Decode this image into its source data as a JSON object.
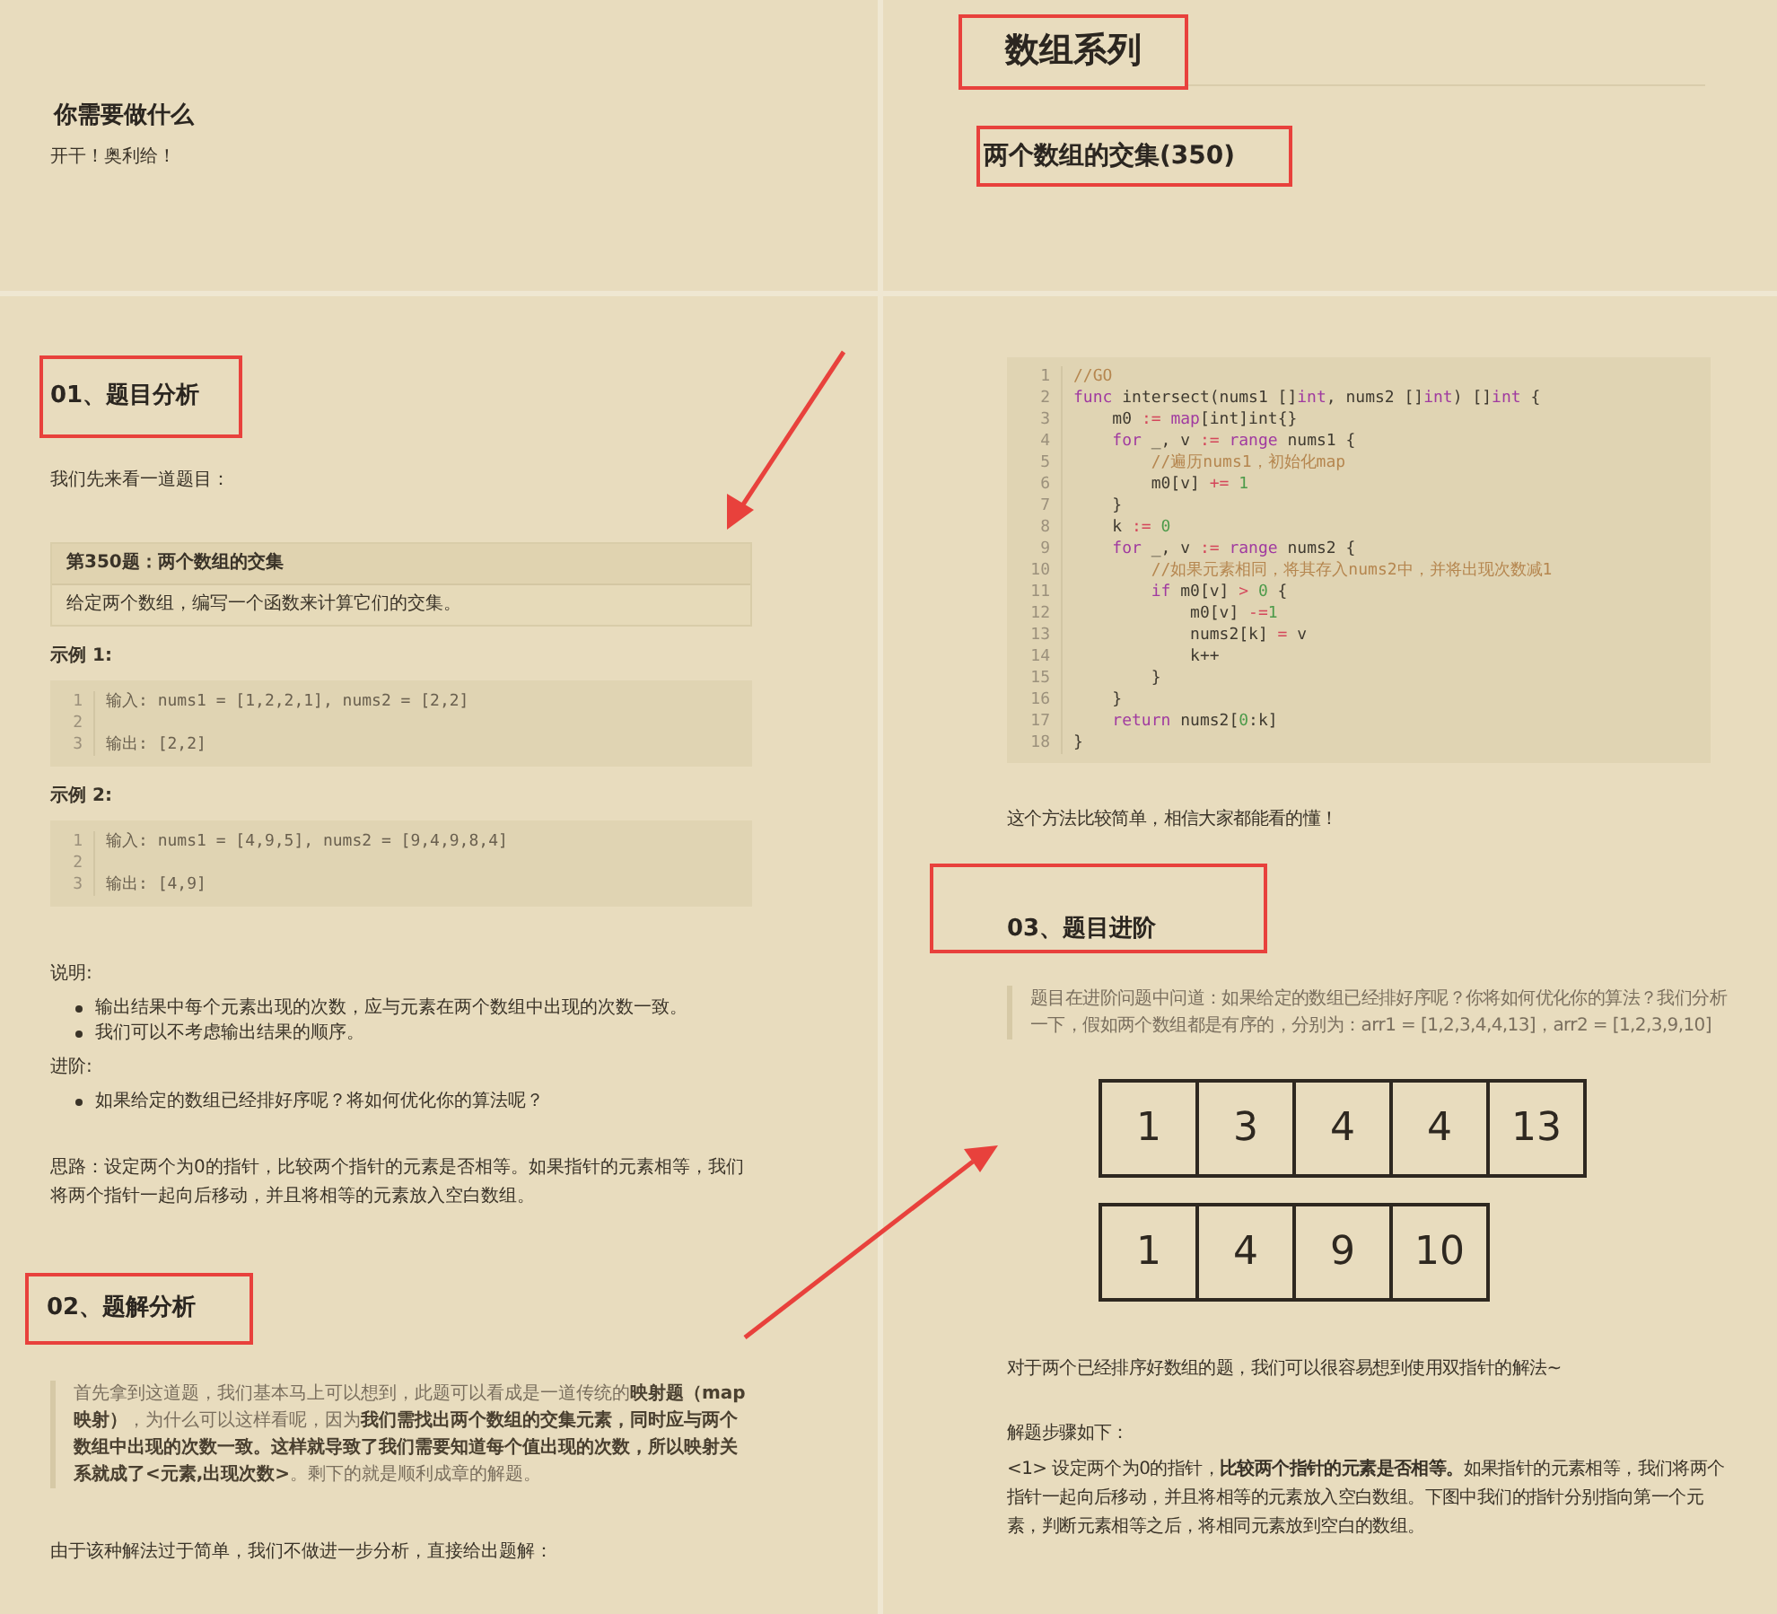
{
  "left_top": {
    "heading": {
      "text": "你需要做什么",
      "highlighted": false
    },
    "text": "开干！奥利给！"
  },
  "right_top": {
    "series_title": {
      "text": "数组系列",
      "highlighted": true
    },
    "article_title": {
      "text": "两个数组的交集(350)",
      "highlighted": true
    }
  },
  "left_bottom": {
    "section_1": {
      "heading": {
        "text": "01、题目分析",
        "highlighted": true
      },
      "intro": "我们先来看一道题目：",
      "problem": {
        "title": "第350题：两个数组的交集",
        "body": "给定两个数组，编写一个函数来计算它们的交集。"
      },
      "examples": [
        {
          "label": "示例 1:",
          "lines": [
            {
              "n": "1",
              "t": "输入: nums1 = [1,2,2,1], nums2 = [2,2]"
            },
            {
              "n": "2"
            },
            {
              "n": "3",
              "t": "输出: [2,2]"
            }
          ]
        },
        {
          "label": "示例 2:",
          "lines": [
            {
              "n": "1",
              "t": "输入: nums1 = [4,9,5], nums2 = [9,4,9,8,4]"
            },
            {
              "n": "2"
            },
            {
              "n": "3",
              "t": "输出: [4,9]"
            }
          ]
        }
      ],
      "notes_label": "说明:",
      "notes": [
        "输出结果中每个元素出现的次数，应与元素在两个数组中出现的次数一致。",
        "我们可以不考虑输出结果的顺序。"
      ],
      "advanced_label": "进阶:",
      "advanced": [
        "如果给定的数组已经排好序呢？将如何优化你的算法呢？"
      ],
      "idea": "思路：设定两个为0的指针，比较两个指针的元素是否相等。如果指针的元素相等，我们将两个指针一起向后移动，并且将相等的元素放入空白数组。"
    },
    "section_2": {
      "heading": {
        "text": "02、题解分析",
        "highlighted": true
      },
      "quote": "首先拿到这道题，我们基本马上可以想到，此题可以看成是一道传统的**映射题（map映射）**，为什么可以这样看呢，因为**我们需找出两个数组的交集元素，同时应与两个数组中出现的次数一致。这样就导致了我们需要知道每个值出现的次数，所以映射关系就成了<元素,出现次数>**。剩下的就是顺利成章的解题。",
      "text": "由于该种解法过于简单，我们不做进一步分析，直接给出题解："
    }
  },
  "right_bottom": {
    "code": [
      {
        "n": "1",
        "tokens": [
          {
            "kind": "comment",
            "text": "//GO"
          }
        ]
      },
      {
        "n": "2",
        "tokens": [
          {
            "kind": "kw",
            "text": "func"
          },
          {
            "kind": "plain",
            "text": " intersect(nums1 []"
          },
          {
            "kind": "kw",
            "text": "int"
          },
          {
            "kind": "plain",
            "text": ", nums2 []"
          },
          {
            "kind": "kw",
            "text": "int"
          },
          {
            "kind": "plain",
            "text": ") []"
          },
          {
            "kind": "kw",
            "text": "int"
          },
          {
            "kind": "plain",
            "text": " {"
          }
        ]
      },
      {
        "n": "3",
        "tokens": [
          {
            "kind": "plain",
            "text": "    m0 "
          },
          {
            "kind": "op",
            "text": ":="
          },
          {
            "kind": "kw",
            "text": " map"
          },
          {
            "kind": "plain",
            "text": "[int]int{}"
          }
        ]
      },
      {
        "n": "4",
        "tokens": [
          {
            "kind": "kw",
            "text": "    for"
          },
          {
            "kind": "plain",
            "text": " _, v "
          },
          {
            "kind": "op",
            "text": ":="
          },
          {
            "kind": "kw",
            "text": " range"
          },
          {
            "kind": "plain",
            "text": " nums1 {"
          }
        ]
      },
      {
        "n": "5",
        "tokens": [
          {
            "kind": "comment",
            "text": "        //遍历nums1，初始化map"
          }
        ]
      },
      {
        "n": "6",
        "tokens": [
          {
            "kind": "plain",
            "text": "        m0[v] "
          },
          {
            "kind": "op",
            "text": "+="
          },
          {
            "kind": "num",
            "text": " 1"
          }
        ]
      },
      {
        "n": "7",
        "tokens": [
          {
            "kind": "plain",
            "text": "    }"
          }
        ]
      },
      {
        "n": "8",
        "tokens": [
          {
            "kind": "plain",
            "text": "    k "
          },
          {
            "kind": "op",
            "text": ":="
          },
          {
            "kind": "num",
            "text": " 0"
          }
        ]
      },
      {
        "n": "9",
        "tokens": [
          {
            "kind": "kw",
            "text": "    for"
          },
          {
            "kind": "plain",
            "text": " _, v "
          },
          {
            "kind": "op",
            "text": ":="
          },
          {
            "kind": "kw",
            "text": " range"
          },
          {
            "kind": "plain",
            "text": " nums2 {"
          }
        ]
      },
      {
        "n": "10",
        "tokens": [
          {
            "kind": "comment",
            "text": "        //如果元素相同，将其存入nums2中，并将出现次数减1"
          }
        ]
      },
      {
        "n": "11",
        "tokens": [
          {
            "kind": "kw",
            "text": "        if"
          },
          {
            "kind": "plain",
            "text": " m0[v] "
          },
          {
            "kind": "op",
            "text": ">"
          },
          {
            "kind": "num",
            "text": " 0"
          },
          {
            "kind": "plain",
            "text": " {"
          }
        ]
      },
      {
        "n": "12",
        "tokens": [
          {
            "kind": "plain",
            "text": "            m0[v] "
          },
          {
            "kind": "op",
            "text": "-="
          },
          {
            "kind": "num",
            "text": "1"
          }
        ]
      },
      {
        "n": "13",
        "tokens": [
          {
            "kind": "plain",
            "text": "            nums2[k] "
          },
          {
            "kind": "op",
            "text": "="
          },
          {
            "kind": "plain",
            "text": " v"
          }
        ]
      },
      {
        "n": "14",
        "tokens": [
          {
            "kind": "plain",
            "text": "            k++"
          }
        ]
      },
      {
        "n": "15",
        "tokens": [
          {
            "kind": "plain",
            "text": "        }"
          }
        ]
      },
      {
        "n": "16",
        "tokens": [
          {
            "kind": "plain",
            "text": "    }"
          }
        ]
      },
      {
        "n": "17",
        "tokens": [
          {
            "kind": "kw",
            "text": "    return"
          },
          {
            "kind": "plain",
            "text": " nums2["
          },
          {
            "kind": "num",
            "text": "0"
          },
          {
            "kind": "plain",
            "text": ":k]"
          }
        ]
      },
      {
        "n": "18",
        "tokens": [
          {
            "kind": "plain",
            "text": "}"
          }
        ]
      }
    ],
    "comment": "这个方法比较简单，相信大家都能看的懂！",
    "section_3": {
      "heading": {
        "text": "03、题目进阶",
        "highlighted": true
      },
      "quote": "题目在进阶问题中问道：如果给定的数组已经排好序呢？你将如何优化你的算法？我们分析一下，假如两个数组都是有序的，分别为：arr1 = [1,2,3,4,4,13]，arr2 = [1,2,3,9,10]",
      "diagram": {
        "rows": [
          [
            "1",
            "3",
            "4",
            "4",
            "13"
          ],
          [
            "1",
            "4",
            "9",
            "10"
          ]
        ]
      },
      "text": "对于两个已经排序好数组的题，我们可以很容易想到使用双指针的解法~",
      "steps_label": "解题步骤如下：",
      "step": "<1> 设定两个为0的指针，**比较两个指针的元素是否相等。**如果指针的元素相等，我们将两个指针一起向后移动，并且将相等的元素放入空白数组。下图中我们的指针分别指向第一个元素，判断元素相等之后，将相同元素放到空白的数组。"
    }
  }
}
